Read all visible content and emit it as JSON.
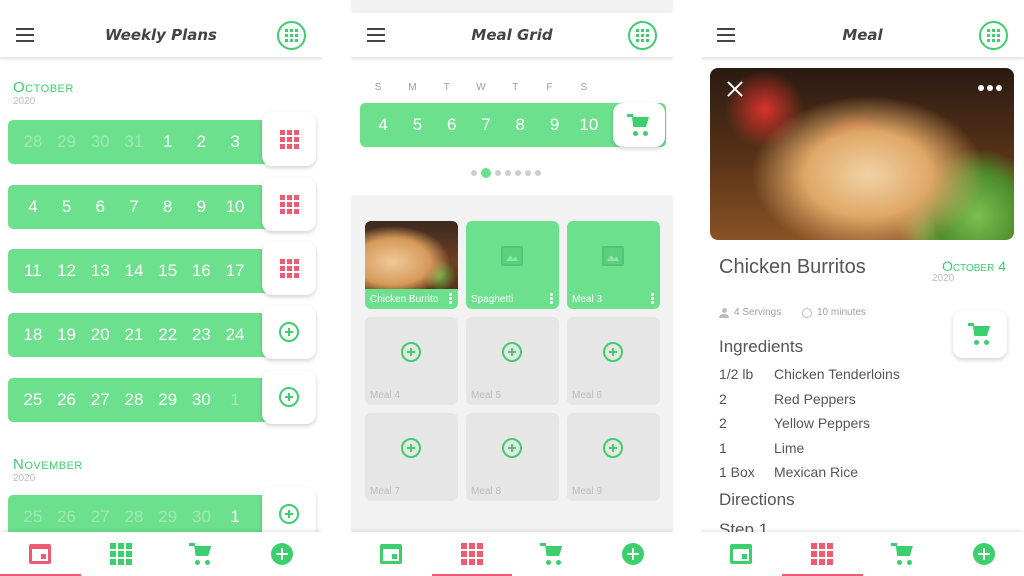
{
  "colors": {
    "accent": "#6de08d",
    "accent_dark": "#3ccf6d",
    "active": "#ef5b71"
  },
  "screen1": {
    "title": "Weekly Plans",
    "months": [
      {
        "name": "October",
        "year": "2020"
      },
      {
        "name": "November",
        "year": "2020"
      }
    ],
    "weeks": [
      {
        "days": [
          "28",
          "29",
          "30",
          "31",
          "1",
          "2",
          "3"
        ],
        "dim_count": 4,
        "action": "grid-icon"
      },
      {
        "days": [
          "4",
          "5",
          "6",
          "7",
          "8",
          "9",
          "10"
        ],
        "dim_count": 0,
        "action": "grid-icon"
      },
      {
        "days": [
          "11",
          "12",
          "13",
          "14",
          "15",
          "16",
          "17"
        ],
        "dim_count": 0,
        "action": "grid-icon"
      },
      {
        "days": [
          "18",
          "19",
          "20",
          "21",
          "22",
          "23",
          "24"
        ],
        "dim_count": 0,
        "action": "add-icon"
      },
      {
        "days": [
          "25",
          "26",
          "27",
          "28",
          "29",
          "30",
          "1"
        ],
        "dim_count": 0,
        "action": "add-icon"
      },
      {
        "days": [
          "25",
          "26",
          "27",
          "28",
          "29",
          "30",
          "1"
        ],
        "dim_count": 6,
        "action": "add-icon"
      }
    ]
  },
  "screen2": {
    "title": "Meal Grid",
    "dow": [
      "S",
      "M",
      "T",
      "W",
      "T",
      "F",
      "S"
    ],
    "days": [
      "4",
      "5",
      "6",
      "7",
      "8",
      "9",
      "10"
    ],
    "pager": {
      "count": 7,
      "active": 1
    },
    "meals": [
      {
        "label": "Chicken Burrito",
        "kind": "photo"
      },
      {
        "label": "Spaghetti",
        "kind": "green"
      },
      {
        "label": "Meal 3",
        "kind": "green"
      },
      {
        "label": "Meal 4",
        "kind": "empty"
      },
      {
        "label": "Meal 5",
        "kind": "empty"
      },
      {
        "label": "Meal 6",
        "kind": "empty"
      },
      {
        "label": "Meal 7",
        "kind": "empty"
      },
      {
        "label": "Meal 8",
        "kind": "empty"
      },
      {
        "label": "Meal 9",
        "kind": "empty"
      }
    ]
  },
  "screen3": {
    "title": "Meal",
    "recipe_title": "Chicken Burritos",
    "month": "October 4",
    "year": "2020",
    "servings": "4 Servings",
    "time": "10 minutes",
    "ingredients_heading": "Ingredients",
    "ingredients": [
      {
        "qty": "1/2 lb",
        "name": "Chicken Tenderloins"
      },
      {
        "qty": "2",
        "name": "Red Peppers"
      },
      {
        "qty": "2",
        "name": "Yellow Peppers"
      },
      {
        "qty": "1",
        "name": "Lime"
      },
      {
        "qty": "1 Box",
        "name": "Mexican Rice"
      }
    ],
    "directions_heading": "Directions",
    "step": "Step 1"
  },
  "nav": {
    "tabs": [
      "calendar-icon",
      "grid-icon",
      "cart-icon",
      "add-icon"
    ],
    "active": {
      "screen1": 0,
      "screen2": 1,
      "screen3": 1
    }
  }
}
